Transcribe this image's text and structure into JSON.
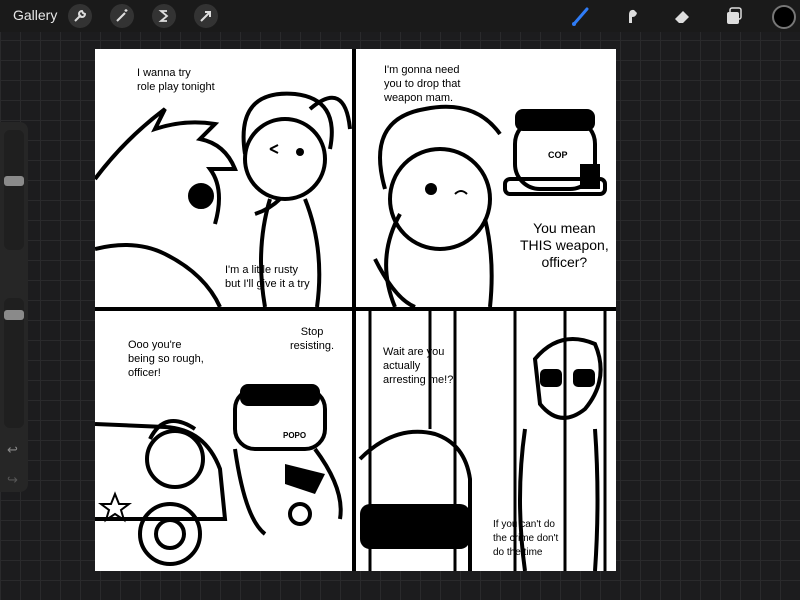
{
  "app": {
    "gallery_label": "Gallery"
  },
  "toolbar_left": [
    {
      "name": "wrench-icon"
    },
    {
      "name": "magic-wand-icon"
    },
    {
      "name": "selection-s-icon"
    },
    {
      "name": "transform-arrow-icon"
    }
  ],
  "toolbar_right": [
    {
      "name": "brush-icon",
      "active_color": "#2f7cf6"
    },
    {
      "name": "smudge-icon"
    },
    {
      "name": "eraser-icon"
    },
    {
      "name": "layers-icon"
    }
  ],
  "current_color": "#000000",
  "sidebar": {
    "undo_glyph": "↩",
    "redo_glyph": "↪",
    "size_slider_level": 0.2,
    "opacity_slider_level": 0.1
  },
  "comic": {
    "panel1": {
      "speech1": "I wanna try\nrole play tonight",
      "speech2": "I'm a little rusty\nbut I'll give it a try"
    },
    "panel2": {
      "speech1": "I'm gonna need\nyou to drop that\nweapon mam.",
      "speech2": "You mean\nTHIS weapon,\nofficer?",
      "badge": "COP"
    },
    "panel3": {
      "speech1": "Ooo you're\nbeing so rough,\nofficer!",
      "speech2": "Stop\nresisting.",
      "badge": "POPO"
    },
    "panel4": {
      "speech1": "Wait are you\nactually\narresting me!?",
      "speech2": "If you can't do\nthe crime don't\ndo the time"
    }
  }
}
